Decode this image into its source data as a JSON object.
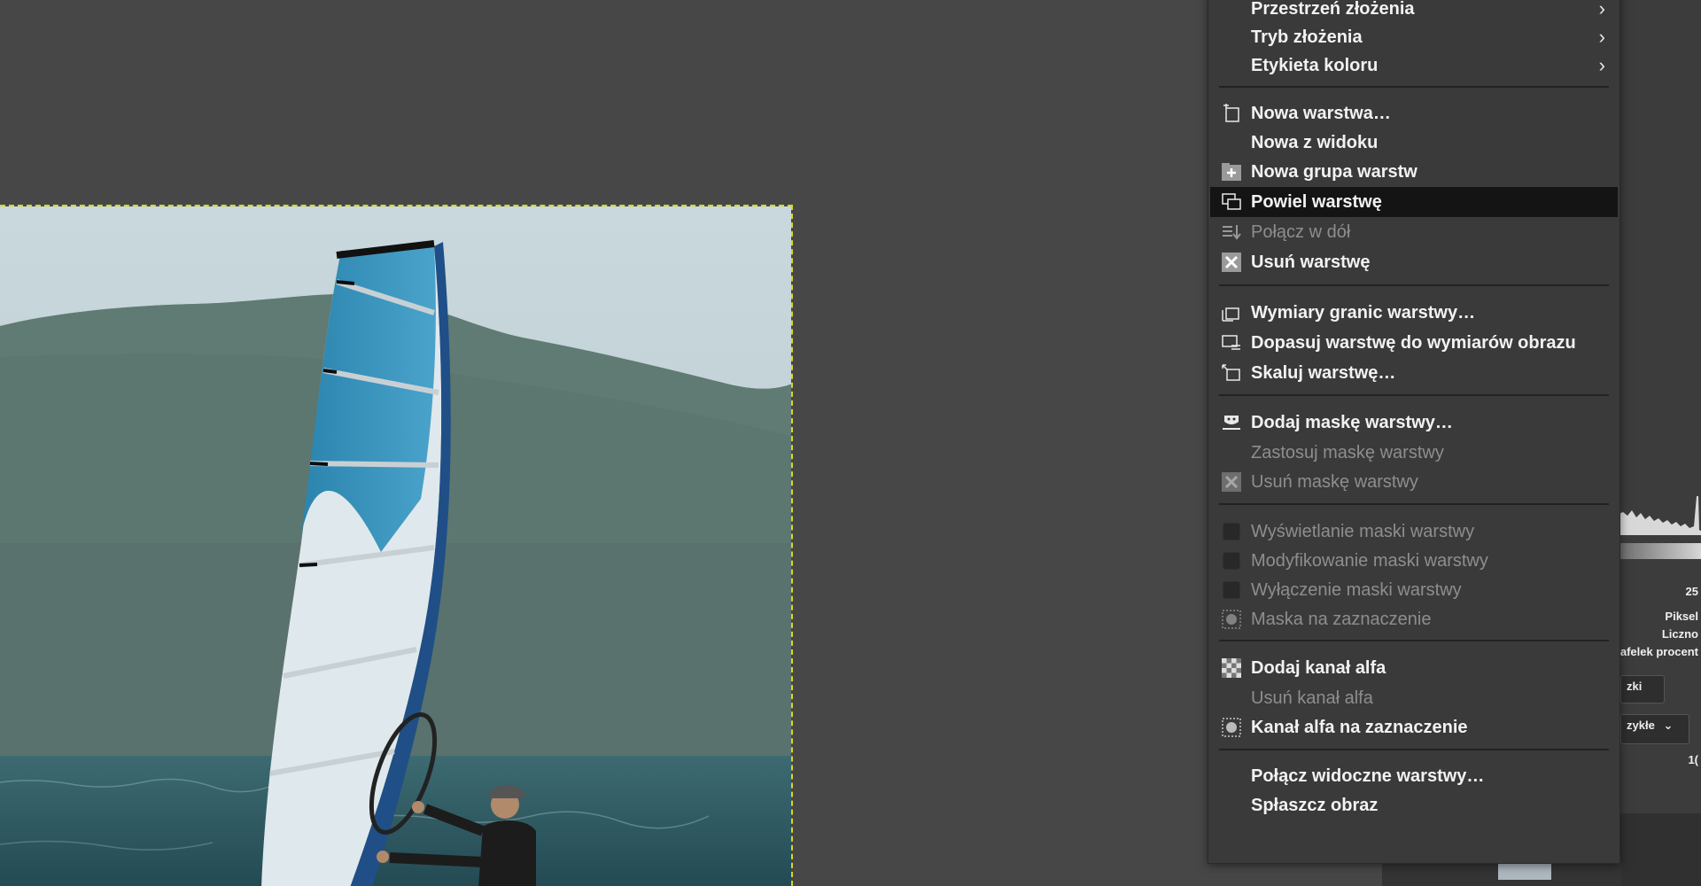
{
  "menu": {
    "items": [
      {
        "label": "Przestrzeń złożenia",
        "icon": "none",
        "submenu": true,
        "disabled": false
      },
      {
        "label": "Tryb złożenia",
        "icon": "none",
        "submenu": true,
        "disabled": false
      },
      {
        "label": "Etykieta koloru",
        "icon": "none",
        "submenu": true,
        "disabled": false
      },
      {
        "label": "Nowa warstwa…",
        "icon": "new-layer-icon",
        "disabled": false
      },
      {
        "label": "Nowa z widoku",
        "icon": "none",
        "disabled": false
      },
      {
        "label": "Nowa grupa warstw",
        "icon": "new-layer-group-icon",
        "disabled": false
      },
      {
        "label": "Powiel warstwę",
        "icon": "duplicate-layer-icon",
        "disabled": false,
        "active": true
      },
      {
        "label": "Połącz w dół",
        "icon": "merge-down-icon",
        "disabled": true
      },
      {
        "label": "Usuń warstwę",
        "icon": "delete-layer-icon",
        "disabled": false
      },
      {
        "label": "Wymiary granic warstwy…",
        "icon": "layer-boundary-icon",
        "disabled": false
      },
      {
        "label": "Dopasuj warstwę do wymiarów obrazu",
        "icon": "layer-to-image-size-icon",
        "disabled": false
      },
      {
        "label": "Skaluj warstwę…",
        "icon": "scale-layer-icon",
        "disabled": false
      },
      {
        "label": "Dodaj maskę warstwy…",
        "icon": "add-mask-icon",
        "disabled": false
      },
      {
        "label": "Zastosuj maskę warstwy",
        "icon": "none",
        "disabled": true
      },
      {
        "label": "Usuń maskę warstwy",
        "icon": "delete-mask-icon",
        "disabled": true
      },
      {
        "label": "Wyświetlanie maski warstwy",
        "icon": "checkbox",
        "disabled": true
      },
      {
        "label": "Modyfikowanie maski warstwy",
        "icon": "checkbox",
        "disabled": true
      },
      {
        "label": "Wyłączenie maski warstwy",
        "icon": "checkbox",
        "disabled": true
      },
      {
        "label": "Maska na zaznaczenie",
        "icon": "mask-to-selection-icon",
        "disabled": true
      },
      {
        "label": "Dodaj kanał alfa",
        "icon": "add-alpha-icon",
        "disabled": false
      },
      {
        "label": "Usuń kanał alfa",
        "icon": "none",
        "disabled": true
      },
      {
        "label": "Kanał alfa na zaznaczenie",
        "icon": "alpha-to-selection-icon",
        "disabled": false
      },
      {
        "label": "Połącz widoczne warstwy…",
        "icon": "none",
        "disabled": false
      },
      {
        "label": "Spłaszcz obraz",
        "icon": "none",
        "disabled": false
      }
    ]
  },
  "dock": {
    "value_25": "25",
    "piksel": "Piksel",
    "licznos": "Liczno",
    "percentyl": "afelek procent",
    "tab_partial": "zki",
    "mode_partial": "zykłe",
    "value_1": "1("
  },
  "colors": {
    "menu_bg": "#3a3a3a",
    "active_bg": "#141414",
    "canvas_bg": "#474747",
    "selection_dash": "#d8d820"
  }
}
